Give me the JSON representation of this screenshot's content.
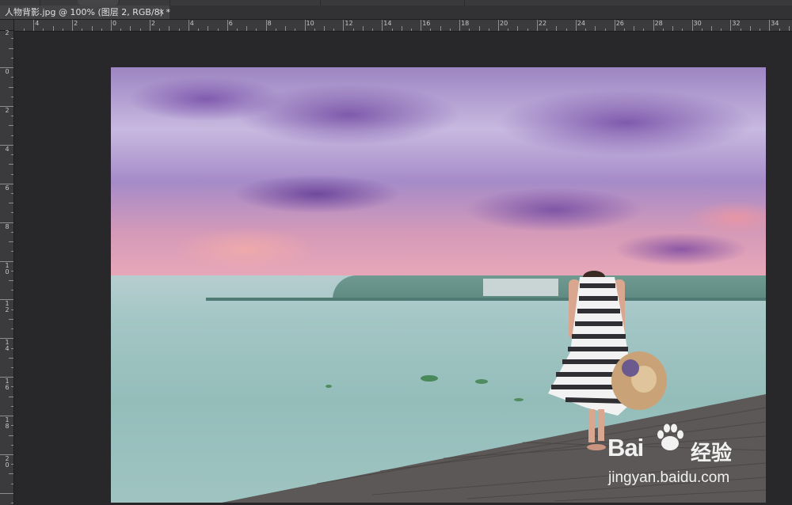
{
  "document_tab": {
    "title": "人物背影.jpg @ 100% (图层 2, RGB/8) *",
    "close_glyph": "×"
  },
  "ruler_horizontal": {
    "labels": [
      "4",
      "2",
      "0",
      "2",
      "4",
      "6",
      "8",
      "10",
      "12",
      "14",
      "16",
      "18",
      "20",
      "22",
      "24",
      "26",
      "28",
      "30",
      "32",
      "34"
    ]
  },
  "ruler_vertical": {
    "labels": [
      "2",
      "0",
      "2",
      "4",
      "6",
      "8",
      "10",
      "12",
      "14",
      "16",
      "18",
      "20"
    ]
  },
  "canvas": {
    "image_description_colors": {
      "sky": "#a58bc8",
      "sea": "#9fc4c2",
      "pier": "#5b5857"
    }
  },
  "watermark": {
    "brand": "Bai",
    "brand_suffix": "经验",
    "url": "jingyan.baidu.com"
  },
  "icons": [
    "close-icon",
    "paw-icon"
  ]
}
